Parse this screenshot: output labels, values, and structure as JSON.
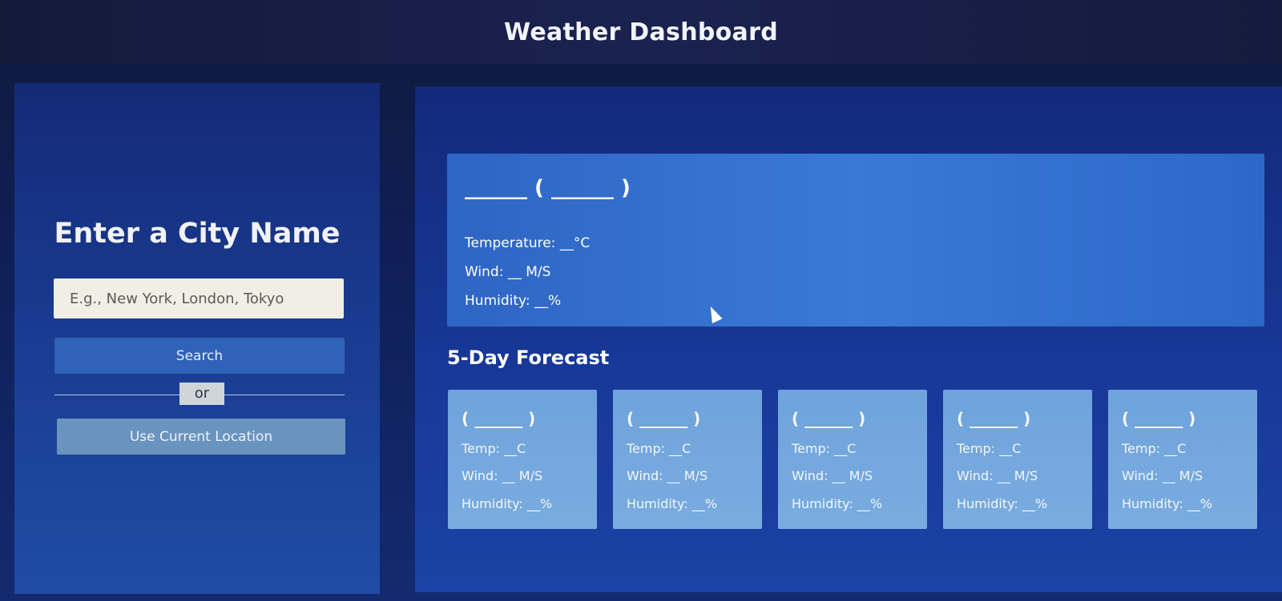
{
  "header": {
    "title": "Weather Dashboard"
  },
  "search_panel": {
    "title": "Enter a City Name",
    "input_placeholder": "E.g., New York, London, Tokyo",
    "search_label": "Search",
    "divider_label": "or",
    "location_label": "Use Current Location"
  },
  "current": {
    "heading": "______ ( ______ )",
    "temperature": "Temperature: __°C",
    "wind": "Wind: __ M/S",
    "humidity": "Humidity: __%"
  },
  "forecast": {
    "title": "5-Day Forecast",
    "days": [
      {
        "date": "( ______ )",
        "temp": "Temp: __C",
        "wind": "Wind: __ M/S",
        "humidity": "Humidity: __%"
      },
      {
        "date": "( ______ )",
        "temp": "Temp: __C",
        "wind": "Wind: __ M/S",
        "humidity": "Humidity: __%"
      },
      {
        "date": "( ______ )",
        "temp": "Temp: __C",
        "wind": "Wind: __ M/S",
        "humidity": "Humidity: __%"
      },
      {
        "date": "( ______ )",
        "temp": "Temp: __C",
        "wind": "Wind: __ M/S",
        "humidity": "Humidity: __%"
      },
      {
        "date": "( ______ )",
        "temp": "Temp: __C",
        "wind": "Wind: __ M/S",
        "humidity": "Humidity: __%"
      }
    ]
  },
  "colors": {
    "accent": "#2f62b9",
    "card": "#3a79d6",
    "forecast_card": "#79acdf"
  }
}
